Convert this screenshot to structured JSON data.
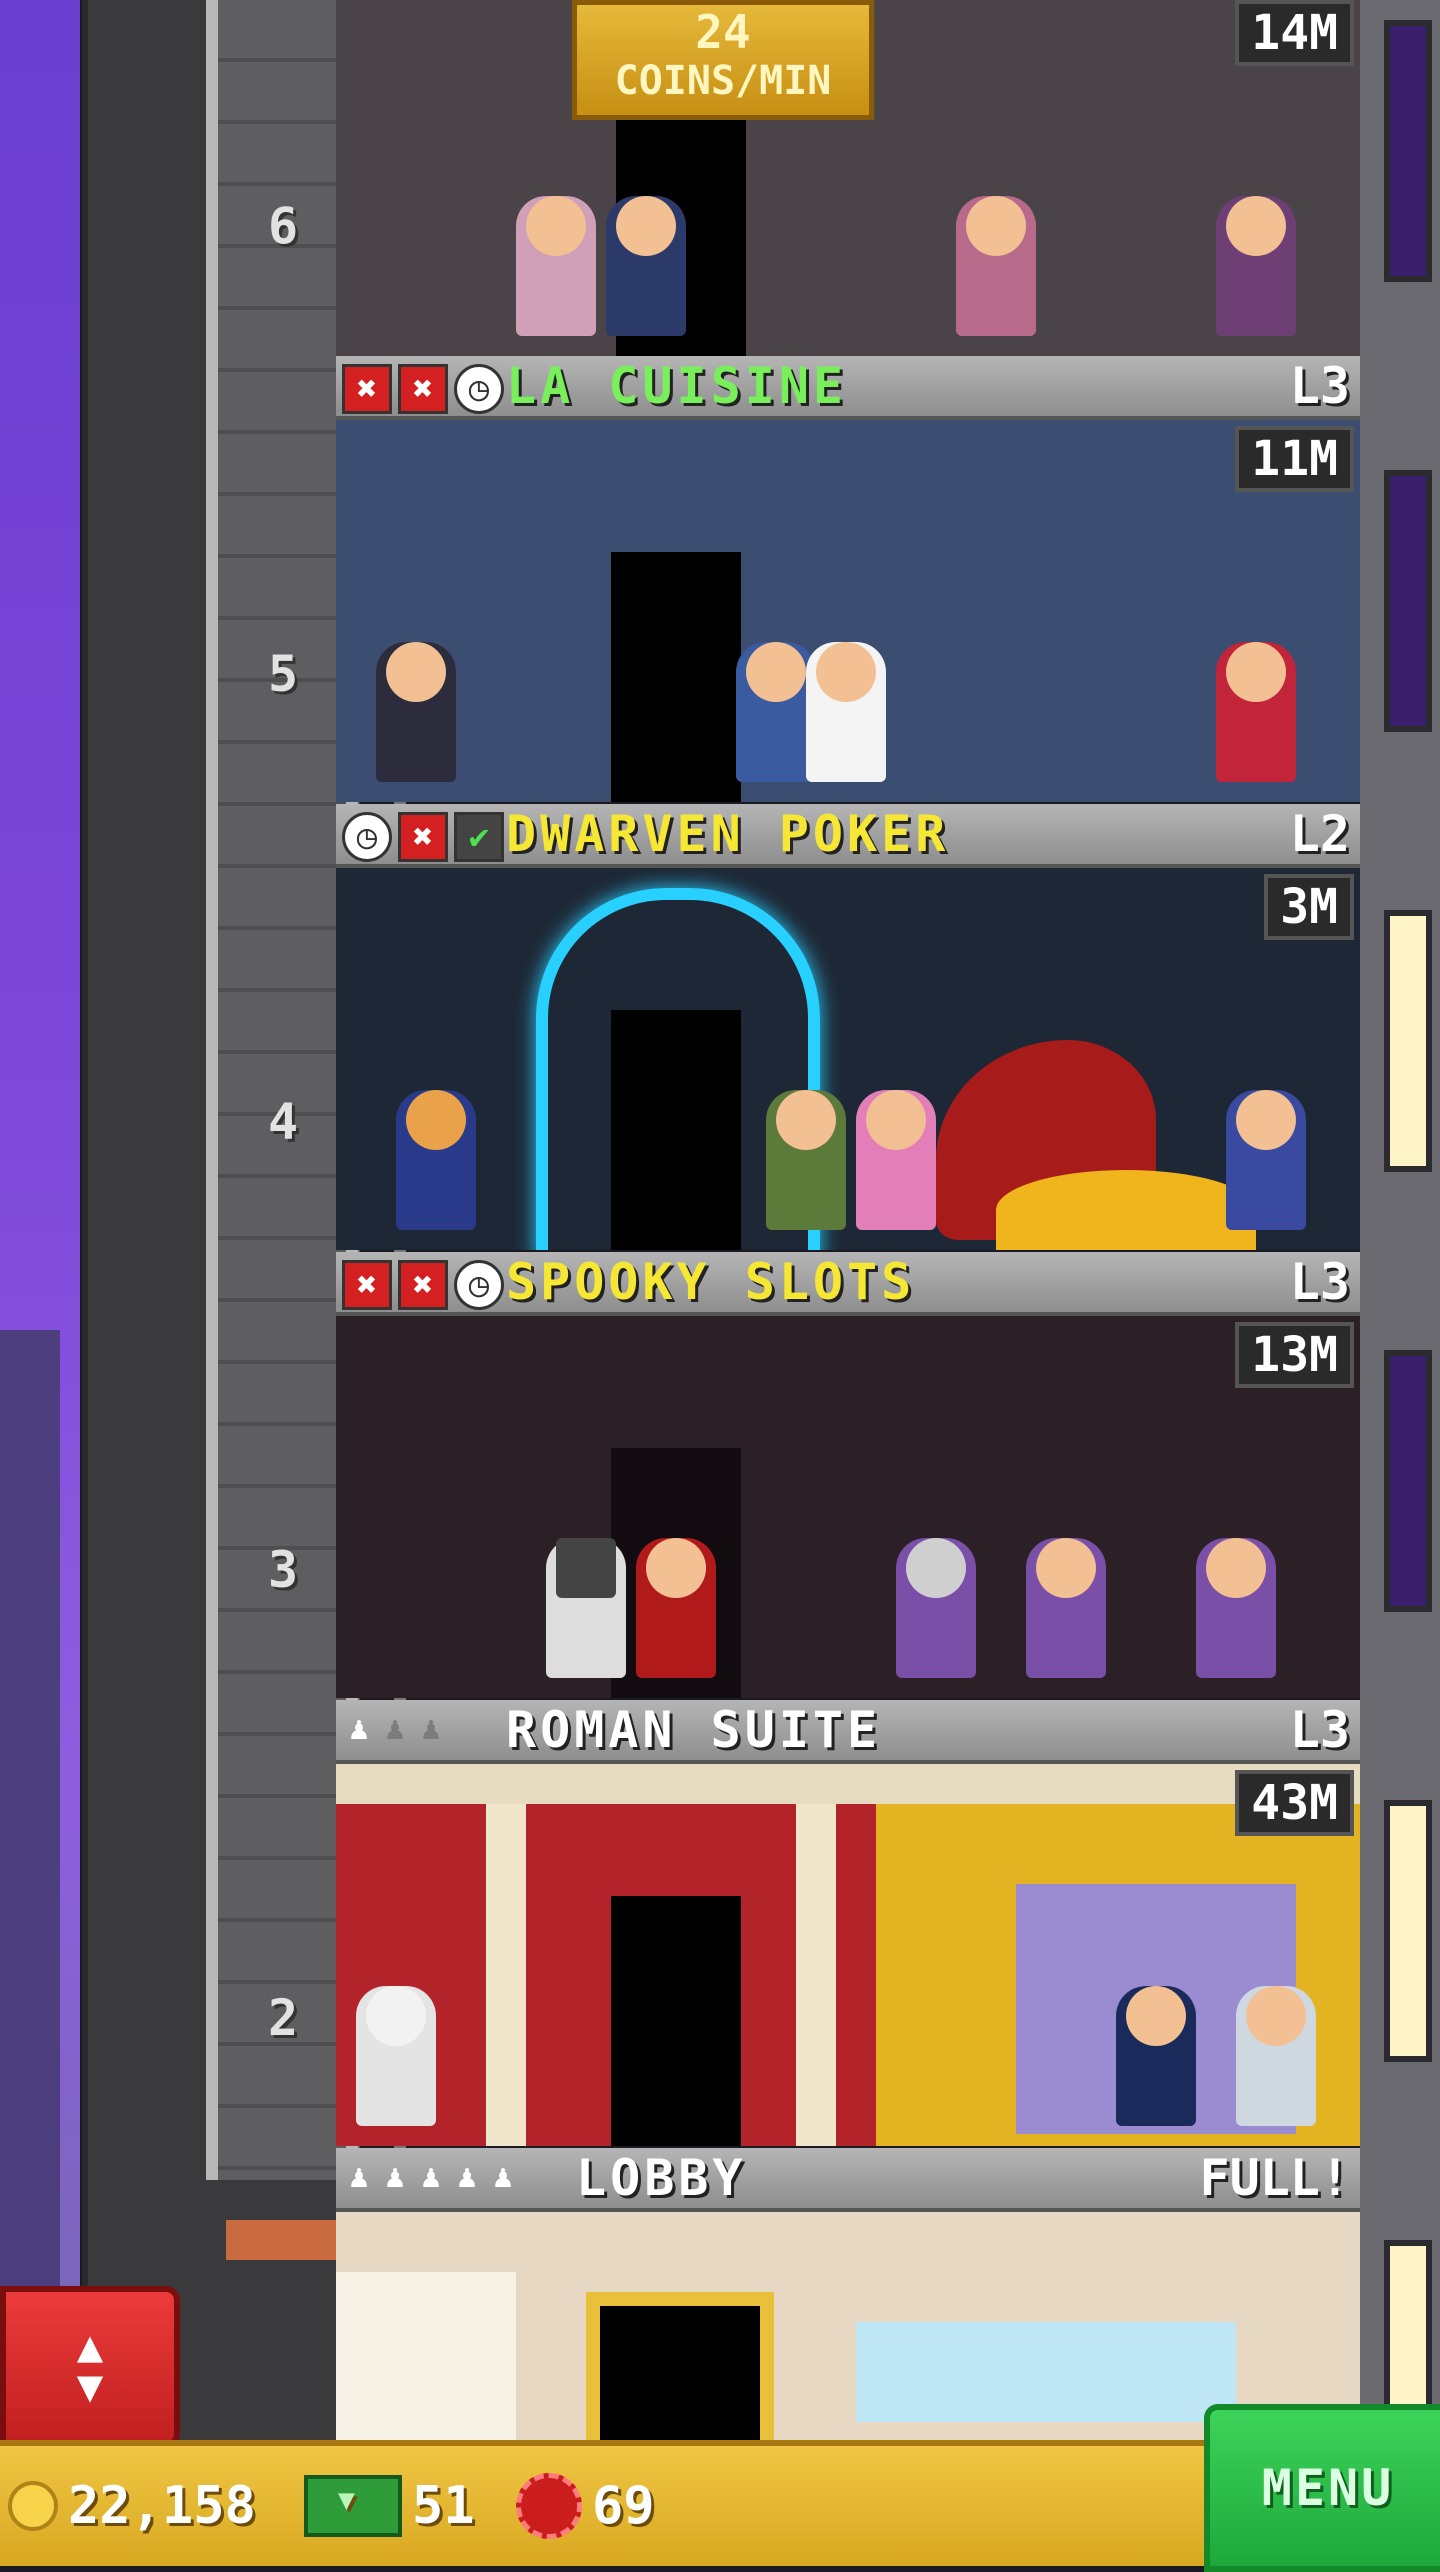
{
  "top_floor": {
    "floor_number": "6",
    "price": "14M",
    "coins_rate_value": "24",
    "coins_rate_unit": "COINS/MIN"
  },
  "floors": [
    {
      "floor_number": "5",
      "name": "LA CUISINE",
      "level": "L3",
      "price": "11M",
      "title_color": "green",
      "stock": [
        "x",
        "x",
        "clock"
      ]
    },
    {
      "floor_number": "4",
      "name": "DWARVEN POKER",
      "level": "L2",
      "price": "3M",
      "title_color": "yellow",
      "stock": [
        "clock",
        "x",
        "check"
      ]
    },
    {
      "floor_number": "3",
      "name": "SPOOKY SLOTS",
      "level": "L3",
      "price": "13M",
      "title_color": "yellow",
      "stock": [
        "x",
        "x",
        "clock"
      ]
    },
    {
      "floor_number": "2",
      "name": "ROMAN SUITE",
      "level": "L3",
      "price": "43M",
      "title_color": "white",
      "residents": 1,
      "capacity": 3
    }
  ],
  "lobby": {
    "name": "LOBBY",
    "status": "FULL!",
    "residents": 5,
    "capacity": 5
  },
  "toolbar": {
    "coins": "22,158",
    "bux": "51",
    "chips": "69",
    "menu_label": "MENU"
  },
  "colors": {
    "green_title": "#79f05b",
    "yellow_title": "#f5e733",
    "stock_out": "#d42020",
    "menu_button": "#1ea83b",
    "toolbar": "#e2b52d"
  }
}
